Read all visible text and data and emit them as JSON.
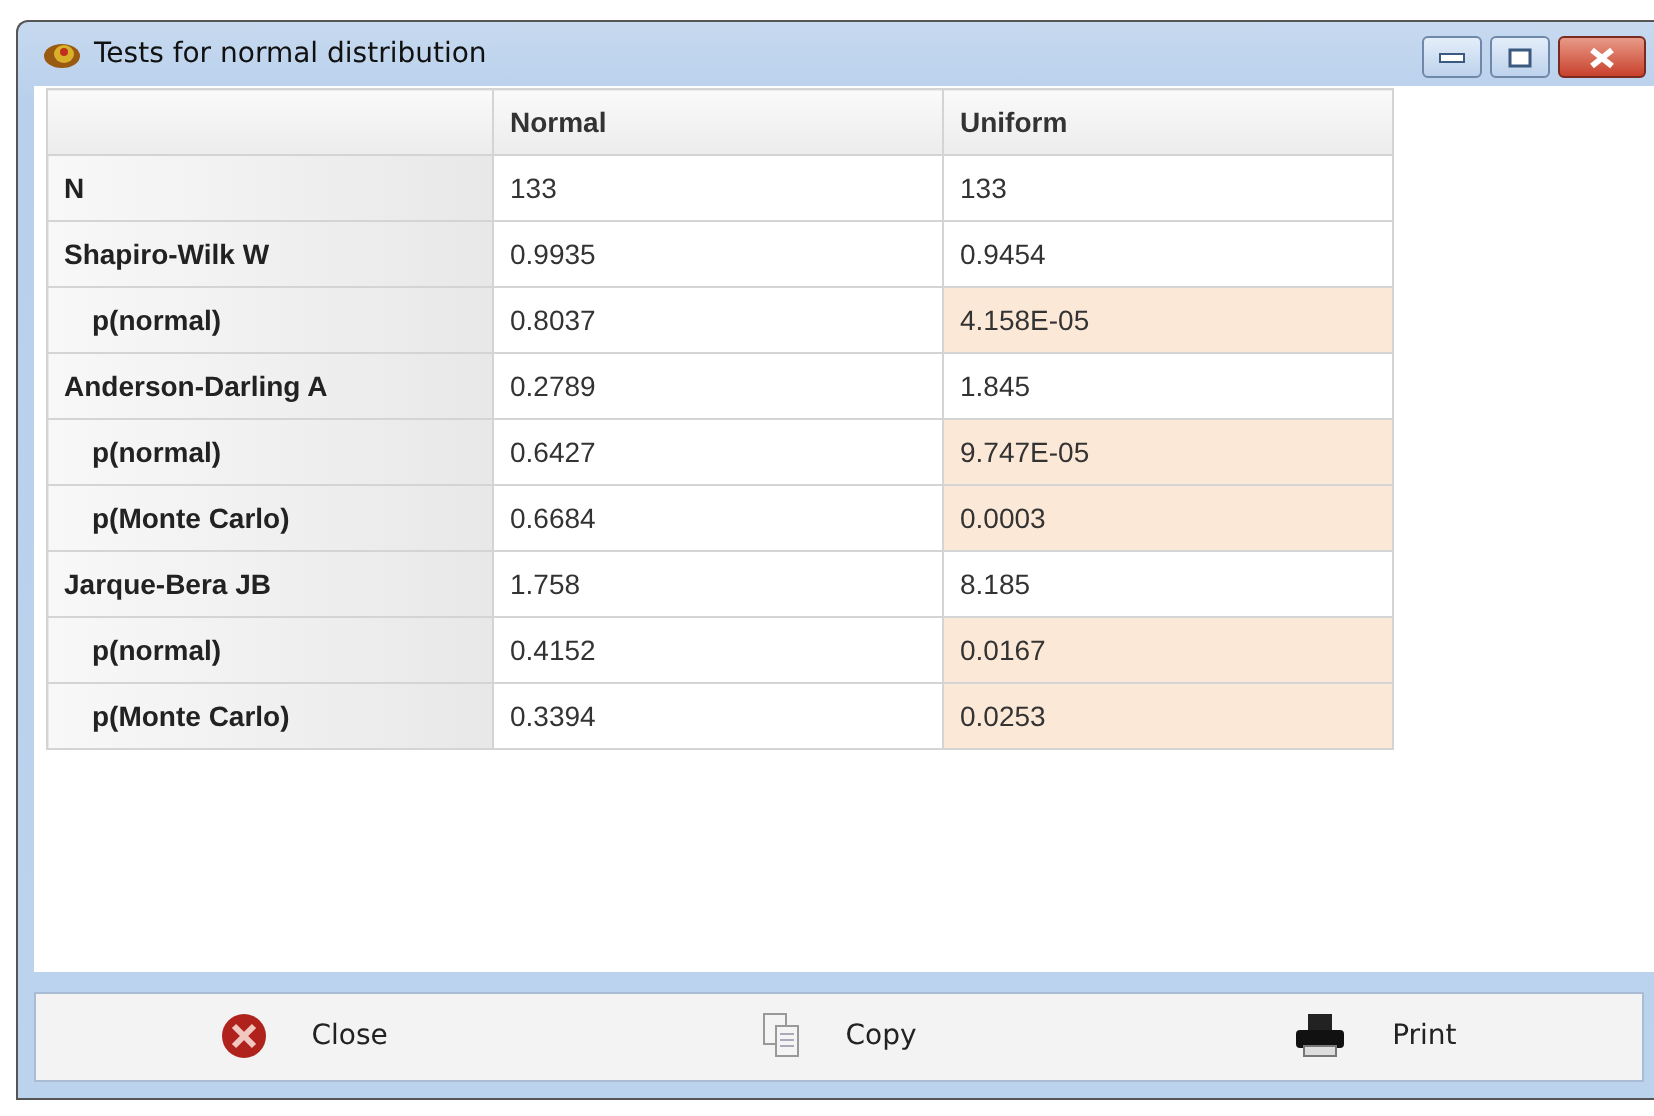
{
  "window": {
    "title": "Tests for normal distribution"
  },
  "table": {
    "columns": [
      "Normal",
      "Uniform"
    ],
    "rows": [
      {
        "label": "N",
        "cells": [
          {
            "text": "133",
            "highlighted": false
          },
          {
            "text": "133",
            "highlighted": false
          }
        ]
      },
      {
        "label": "Shapiro-Wilk W",
        "cells": [
          {
            "text": "0.9935",
            "highlighted": false
          },
          {
            "text": "0.9454",
            "highlighted": false
          }
        ],
        "children": [
          {
            "label": "p(normal)",
            "cells": [
              {
                "text": "0.8037",
                "highlighted": false
              },
              {
                "text": "4.158E-05",
                "highlighted": true
              }
            ]
          }
        ]
      },
      {
        "label": "Anderson-Darling A",
        "cells": [
          {
            "text": "0.2789",
            "highlighted": false
          },
          {
            "text": "1.845",
            "highlighted": false
          }
        ],
        "children": [
          {
            "label": "p(normal)",
            "cells": [
              {
                "text": "0.6427",
                "highlighted": false
              },
              {
                "text": "9.747E-05",
                "highlighted": true
              }
            ]
          },
          {
            "label": "p(Monte Carlo)",
            "cells": [
              {
                "text": "0.6684",
                "highlighted": false
              },
              {
                "text": "0.0003",
                "highlighted": true
              }
            ]
          }
        ]
      },
      {
        "label": "Jarque-Bera JB",
        "cells": [
          {
            "text": "1.758",
            "highlighted": false
          },
          {
            "text": "8.185",
            "highlighted": false
          }
        ],
        "children": [
          {
            "label": "p(normal)",
            "cells": [
              {
                "text": "0.4152",
                "highlighted": false
              },
              {
                "text": "0.0167",
                "highlighted": true
              }
            ]
          },
          {
            "label": "p(Monte Carlo)",
            "cells": [
              {
                "text": "0.3394",
                "highlighted": false
              },
              {
                "text": "0.0253",
                "highlighted": true
              }
            ]
          }
        ]
      }
    ]
  },
  "buttons": [
    {
      "kind": "close",
      "label": "Close"
    },
    {
      "kind": "copy",
      "label": "Copy"
    },
    {
      "kind": "print",
      "label": "Print"
    }
  ]
}
